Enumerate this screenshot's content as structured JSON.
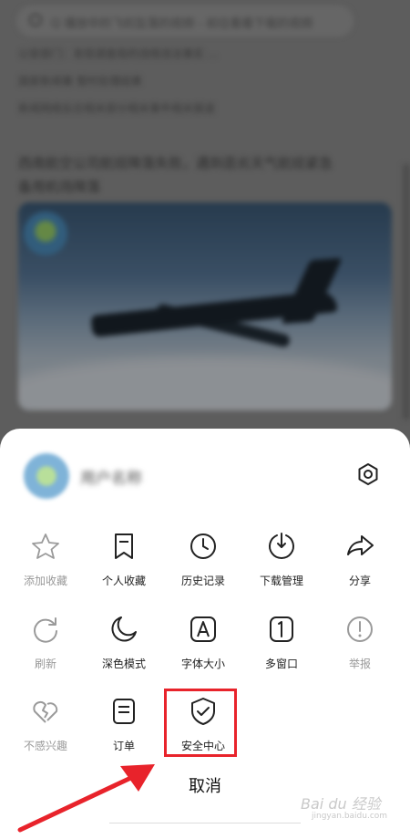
{
  "background": {
    "search_text": "Q 播放中的飞机坠落的视频 - 前往看看下载的视频",
    "line1": "公安部门：发现调查局的违规违法事实 ...",
    "line2": "国家新闻署 暂时处理结果",
    "line3": "新闻网络反应相关部分相关事件相关报道",
    "headline1": "西南航空公司航班降落失败，遇到恶劣天气航班紧急",
    "headline2": "备用机场降落"
  },
  "sheet": {
    "profile_name": "用户名称",
    "cancel_label": "取消",
    "rows": [
      [
        {
          "label": "添加收藏",
          "icon": "star-icon",
          "disabled": true
        },
        {
          "label": "个人收藏",
          "icon": "bookmark-icon",
          "disabled": false
        },
        {
          "label": "历史记录",
          "icon": "clock-icon",
          "disabled": false
        },
        {
          "label": "下载管理",
          "icon": "download-icon",
          "disabled": false
        },
        {
          "label": "分享",
          "icon": "share-icon",
          "disabled": false
        }
      ],
      [
        {
          "label": "刷新",
          "icon": "refresh-icon",
          "disabled": true
        },
        {
          "label": "深色模式",
          "icon": "moon-icon",
          "disabled": false
        },
        {
          "label": "字体大小",
          "icon": "font-size-icon",
          "disabled": false
        },
        {
          "label": "多窗口",
          "icon": "multi-window-icon",
          "disabled": false
        },
        {
          "label": "举报",
          "icon": "report-icon",
          "disabled": true
        }
      ],
      [
        {
          "label": "不感兴趣",
          "icon": "broken-heart-icon",
          "disabled": true
        },
        {
          "label": "订单",
          "icon": "order-icon",
          "disabled": false
        },
        {
          "label": "安全中心",
          "icon": "shield-check-icon",
          "disabled": false
        }
      ]
    ]
  },
  "annotation": {
    "highlight_color": "#e8232b",
    "arrow_color": "#e8232b"
  },
  "watermark": {
    "text": "Bai du 经验",
    "sub": "jingyan.baidu.com"
  }
}
